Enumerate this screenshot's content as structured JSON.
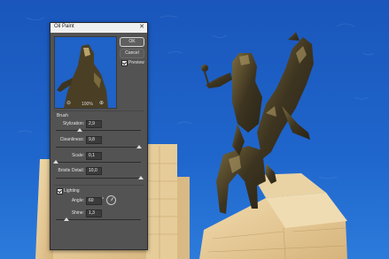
{
  "dialog": {
    "title": "Oil Paint",
    "ok_label": "OK",
    "cancel_label": "Cancel",
    "preview_label": "Preview",
    "preview_checked": true,
    "zoom_value": "100%",
    "brush_section_label": "Brush",
    "stylization_label": "Stylization:",
    "stylization_value": "2,9",
    "stylization_level": 0.28,
    "cleanliness_label": "Cleanliness:",
    "cleanliness_value": "9,8",
    "cleanliness_level": 0.98,
    "scale_label": "Scale:",
    "scale_value": "0,1",
    "scale_level": 0.0,
    "bristle_label": "Bristle Detail:",
    "bristle_value": "10,0",
    "bristle_level": 1.0,
    "lighting_label": "Lighting",
    "lighting_checked": true,
    "angle_label": "Angle:",
    "angle_value": "60",
    "angle_unit": "°",
    "shine_label": "Shine:",
    "shine_value": "1,3",
    "shine_level": 0.13
  },
  "colors": {
    "sky": "#1f62c8",
    "dialog_bg": "#535353",
    "titlebar": "#f0f0f0",
    "stone": "#e4c793",
    "bronze": "#4a3f25"
  }
}
